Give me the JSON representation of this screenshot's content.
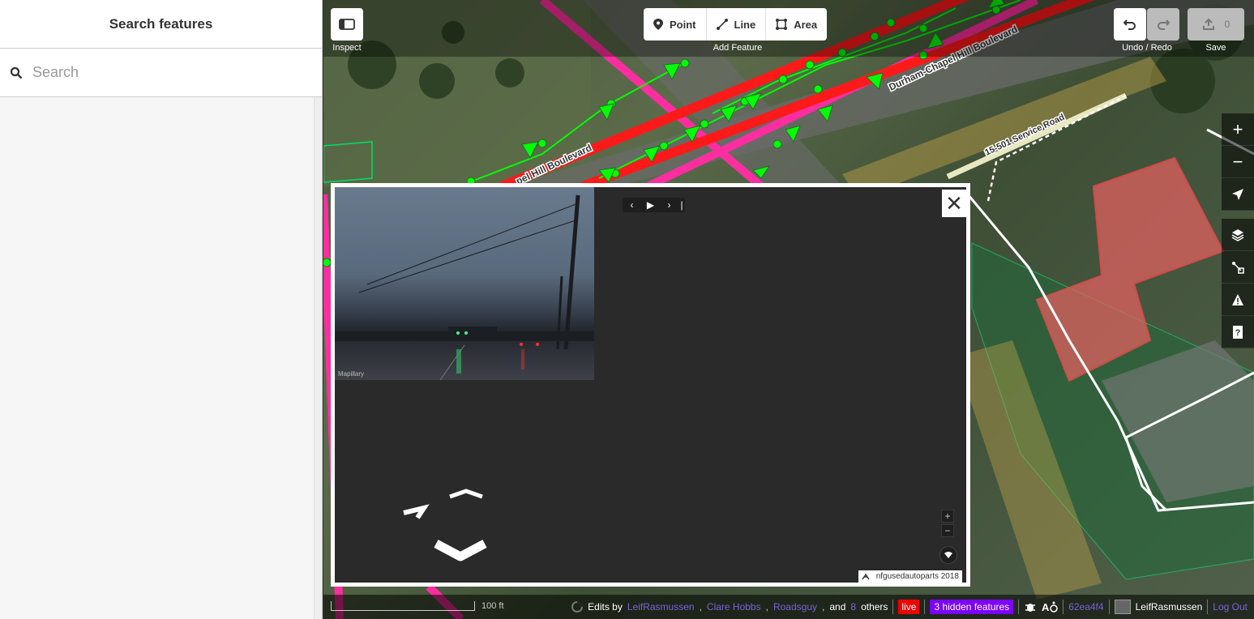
{
  "sidebar": {
    "title": "Search features",
    "search_placeholder": "Search"
  },
  "toolbar": {
    "inspect_label": "Inspect",
    "add_feature_label": "Add Feature",
    "point_label": "Point",
    "line_label": "Line",
    "area_label": "Area",
    "undo_redo_label": "Undo / Redo",
    "save_label": "Save",
    "save_count": "0"
  },
  "map": {
    "road_labels": [
      "Durham-Chapel Hill Boulevard",
      "pel Hill Boulevard",
      "15-501 Service Road"
    ]
  },
  "photo_viewer": {
    "watermark": "Mapillary",
    "zoom_in": "+",
    "zoom_out": "−",
    "close": "✕",
    "attribution": "nfgusedautoparts 2018"
  },
  "footer": {
    "scale_label": "100 ft",
    "edits_by_prefix": "Edits by",
    "editors": [
      "LeifRasmussen",
      "Clare Hobbs",
      "Roadsguy"
    ],
    "and_text": "and",
    "others_count": "8",
    "others_text": "others",
    "live_badge": "live",
    "hidden_features": "3 hidden features",
    "commit_hash": "62ea4f4",
    "username": "LeifRasmussen",
    "logout": "Log Out"
  },
  "colors": {
    "road_primary": "#ff1a1a",
    "road_pink": "#ff2ea0",
    "path_green": "#00ff00",
    "building": "#e06060",
    "accent": "#7a63d6"
  }
}
